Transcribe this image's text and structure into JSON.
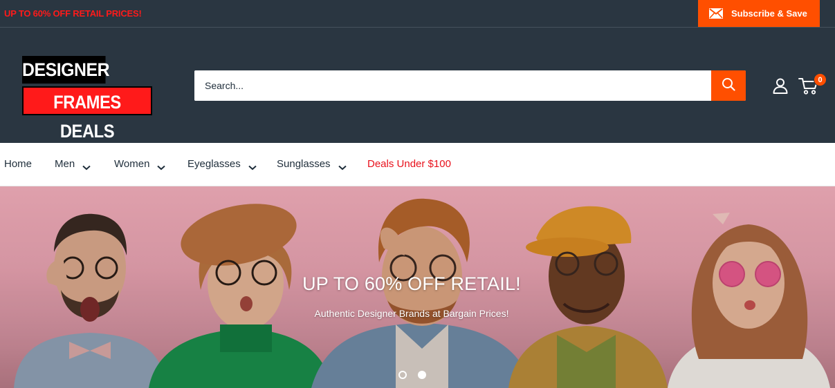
{
  "announcement": {
    "text": "UP TO 60% OFF RETAIL PRICES!",
    "subscribe_label": "Subscribe & Save"
  },
  "header": {
    "logo_line1": "DESIGNER",
    "logo_line2": "FRAMES DEALS",
    "search_placeholder": "Search...",
    "cart_count": "0"
  },
  "nav": {
    "items": [
      {
        "label": "Home"
      },
      {
        "label": "Men"
      },
      {
        "label": "Women"
      },
      {
        "label": "Eyeglasses"
      },
      {
        "label": "Sunglasses"
      },
      {
        "label": "Deals Under $100"
      }
    ]
  },
  "hero": {
    "title": "UP TO 60% OFF RETAIL!",
    "subtitle": "Authentic Designer Brands at Bargain Prices!"
  },
  "colors": {
    "header_bg": "#2a3641",
    "accent": "#ff4f00",
    "sale_red": "#e8101b"
  },
  "icons": [
    "mail-icon",
    "search-icon",
    "account-icon",
    "cart-icon",
    "chevron-down-icon"
  ]
}
